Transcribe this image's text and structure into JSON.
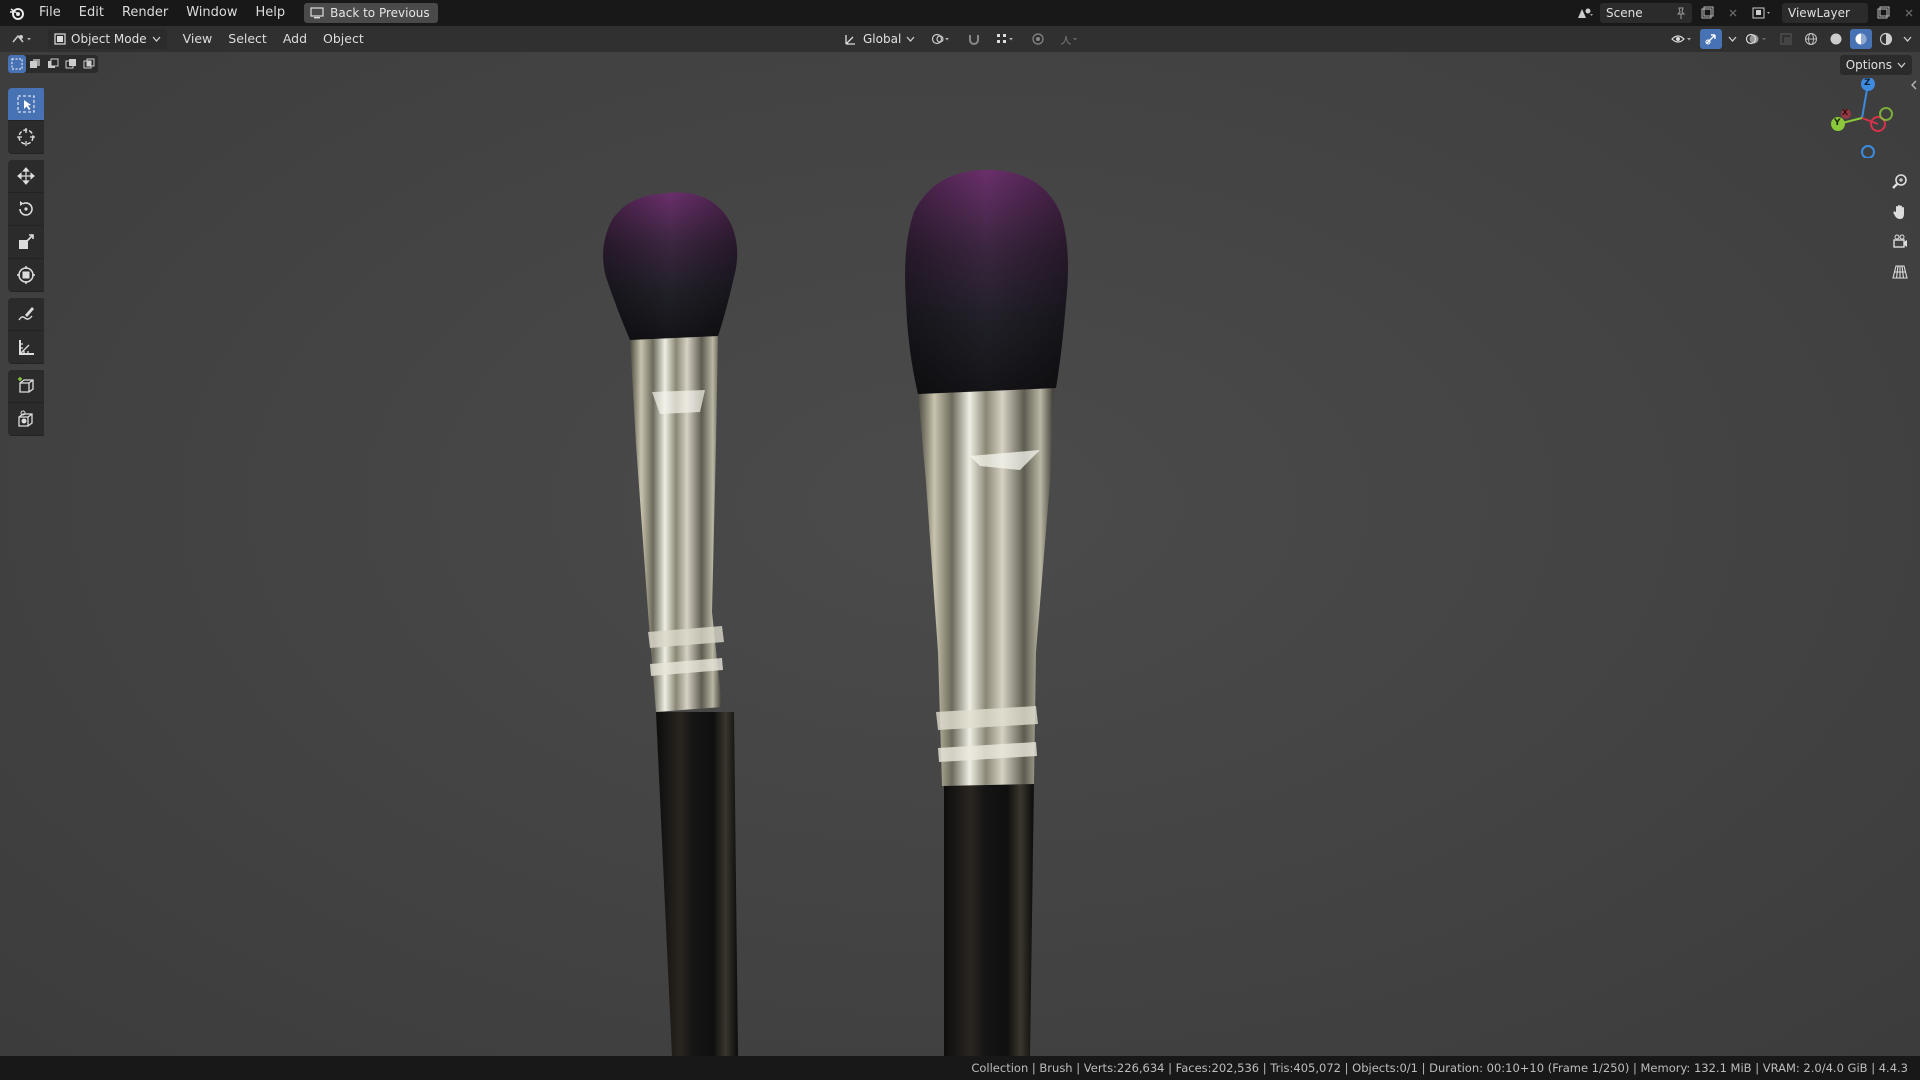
{
  "topbar": {
    "menus": [
      "File",
      "Edit",
      "Render",
      "Window",
      "Help"
    ],
    "back_button": "Back to Previous",
    "scene": "Scene",
    "view_layer": "ViewLayer"
  },
  "header": {
    "mode": "Object Mode",
    "menus": [
      "View",
      "Select",
      "Add",
      "Object"
    ],
    "transform_orientation": "Global"
  },
  "viewport": {
    "options_label": "Options",
    "gizmo_axes": {
      "x": "X",
      "y": "Y",
      "z": "Z"
    }
  },
  "toolbar": {
    "tools": [
      "select-box",
      "cursor",
      "move",
      "rotate",
      "scale",
      "transform",
      "annotate",
      "measure",
      "add-cube",
      "add-object"
    ],
    "active_tool": "select-box"
  },
  "status": {
    "text": "Collection | Brush | Verts:226,634 | Faces:202,536 | Tris:405,072 | Objects:0/1 | Duration: 00:10+10 (Frame 1/250) | Memory: 132.1 MiB | VRAM: 2.0/4.0 GiB | 4.4.3"
  },
  "colors": {
    "accent": "#4772b3",
    "bristle_tip": "#6a2f6b",
    "bristle_base": "#1d1d22",
    "handle": "#151515",
    "axis_x": "#d6334a",
    "axis_y": "#8bc93a",
    "axis_z": "#3d8bdf"
  }
}
